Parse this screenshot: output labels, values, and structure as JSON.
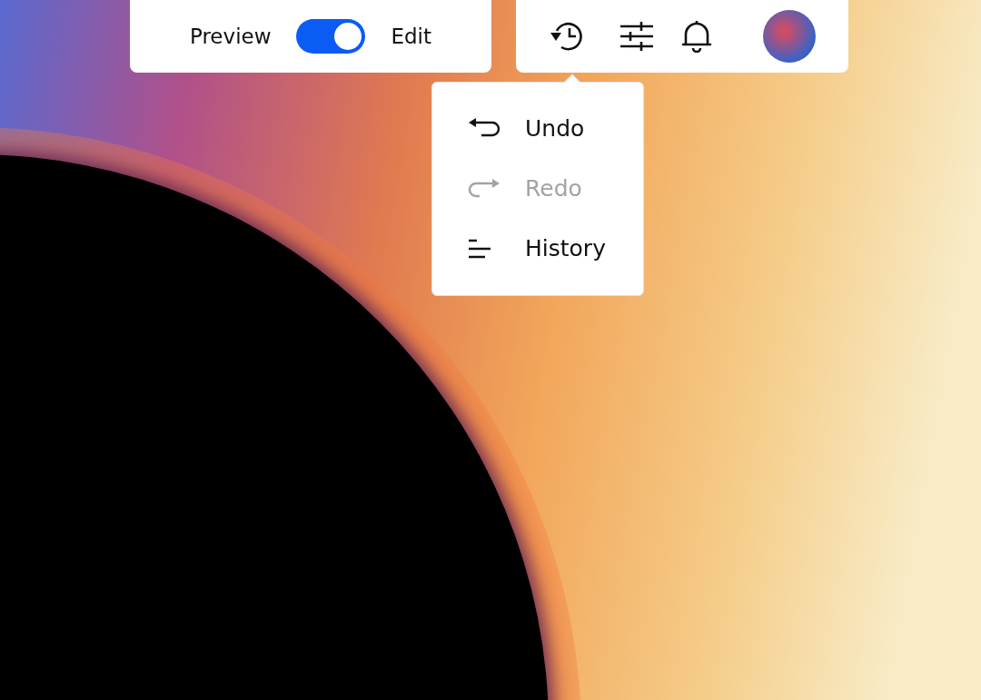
{
  "mode_toggle": {
    "left_label": "Preview",
    "right_label": "Edit",
    "on": true
  },
  "edit_menu": {
    "items": [
      {
        "kind": "undo",
        "label": "Undo",
        "disabled": false
      },
      {
        "kind": "redo",
        "label": "Redo",
        "disabled": true
      },
      {
        "kind": "history",
        "label": "History",
        "disabled": false
      }
    ]
  }
}
